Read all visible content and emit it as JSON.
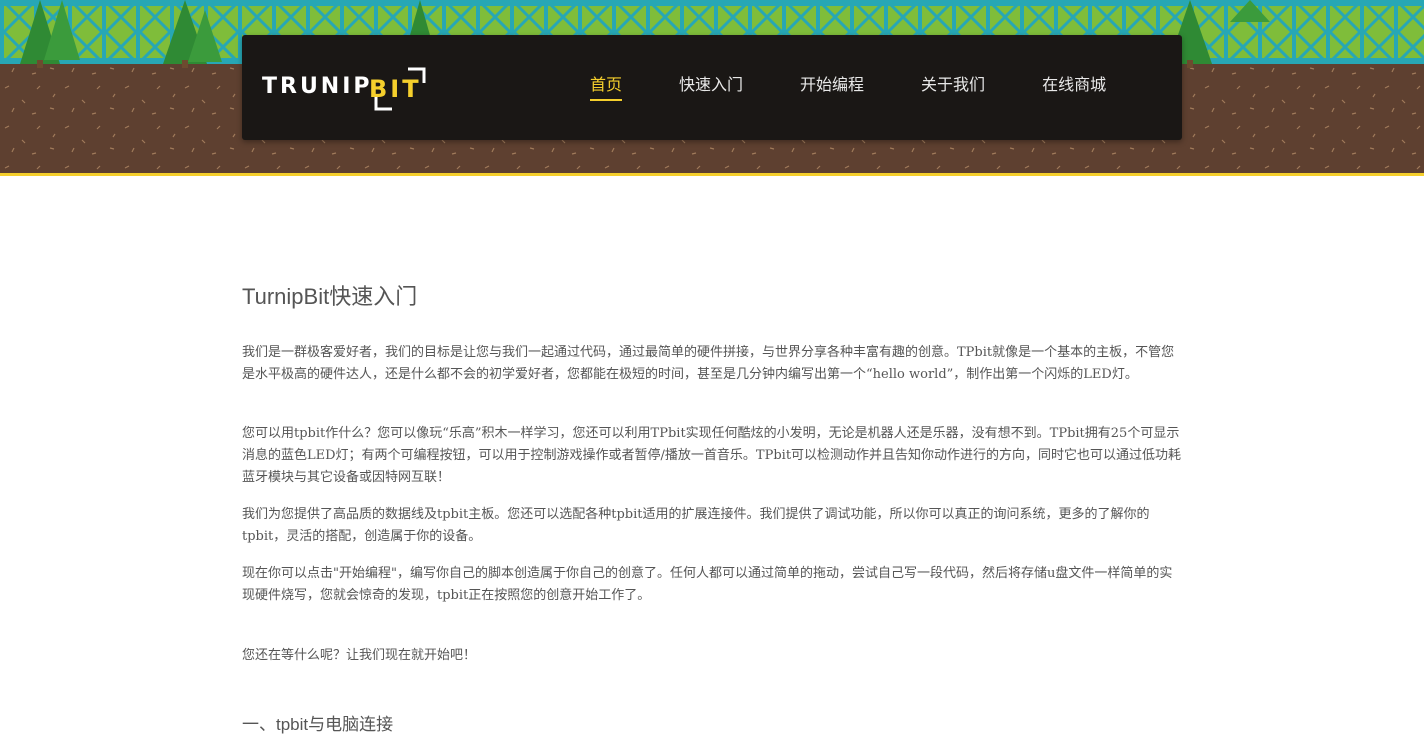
{
  "header": {
    "logo": {
      "part1": "TRUNIP",
      "part2": "BIT"
    },
    "nav": [
      {
        "label": "首页",
        "active": true
      },
      {
        "label": "快速入门",
        "active": false
      },
      {
        "label": "开始编程",
        "active": false
      },
      {
        "label": "关于我们",
        "active": false
      },
      {
        "label": "在线商城",
        "active": false
      }
    ]
  },
  "article": {
    "title": "TurnipBit快速入门",
    "paragraphs": [
      "我们是一群极客爱好者，我们的目标是让您与我们一起通过代码，通过最简单的硬件拼接，与世界分享各种丰富有趣的创意。TPbit就像是一个基本的主板，不管您是水平极高的硬件达人，还是什么都不会的初学爱好者，您都能在极短的时间，甚至是几分钟内编写出第一个“hello world”，制作出第一个闪烁的LED灯。",
      "您可以用tpbit作什么？您可以像玩“乐高”积木一样学习，您还可以利用TPbit实现任何酷炫的小发明，无论是机器人还是乐器，没有想不到。TPbit拥有25个可显示消息的蓝色LED灯；有两个可编程按钮，可以用于控制游戏操作或者暂停/播放一首音乐。TPbit可以检测动作并且告知你动作进行的方向，同时它也可以通过低功耗蓝牙模块与其它设备或因特网互联！",
      "我们为您提供了高品质的数据线及tpbit主板。您还可以选配各种tpbit适用的扩展连接件。我们提供了调试功能，所以你可以真正的询问系统，更多的了解你的tpbit，灵活的搭配，创造属于你的设备。",
      "现在你可以点击\"开始编程\"，编写你自己的脚本创造属于你自己的创意了。任何人都可以通过简单的拖动，尝试自己写一段代码，然后将存储u盘文件一样简单的实现硬件烧写，您就会惊奇的发现，tpbit正在按照您的创意开始工作了。",
      "您还在等什么呢？让我们现在就开始吧！"
    ],
    "section_heading": "一、tpbit与电脑连接"
  },
  "colors": {
    "accent": "#f5cf2c",
    "navbar_bg": "#1a1715",
    "sky": "#8cc63e",
    "railing": "#27a7b5",
    "soil": "#5e4030"
  }
}
